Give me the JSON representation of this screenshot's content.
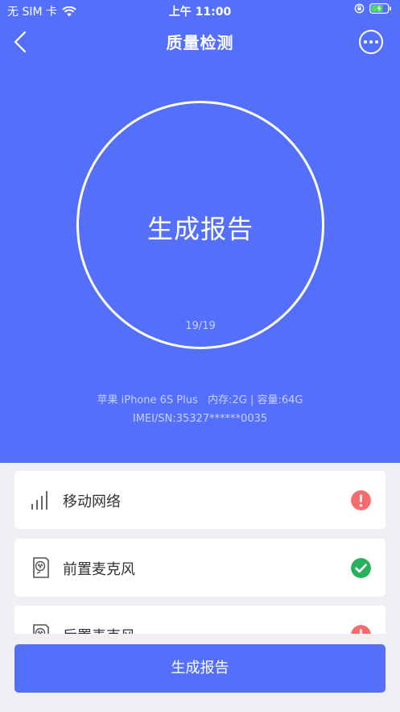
{
  "status_bar": {
    "carrier": "无 SIM 卡",
    "time": "上午 11:00"
  },
  "nav": {
    "title": "质量检测"
  },
  "report_ring": {
    "title": "生成报告",
    "progress": "19/19"
  },
  "device": {
    "line1": "苹果 iPhone 6S Plus   内存:2G | 容量:64G",
    "line2": "IMEI/SN:35327******0035"
  },
  "checks": [
    {
      "label": "移动网络",
      "status": "fail",
      "icon": "signal-icon"
    },
    {
      "label": "前置麦克风",
      "status": "pass",
      "icon": "microphone-icon"
    },
    {
      "label": "后置麦克风",
      "status": "fail",
      "icon": "microphone-icon"
    }
  ],
  "primary_button": {
    "label": "生成报告"
  },
  "colors": {
    "brand": "#5470fb",
    "fail": "#f56c6c",
    "pass": "#27b15c"
  }
}
